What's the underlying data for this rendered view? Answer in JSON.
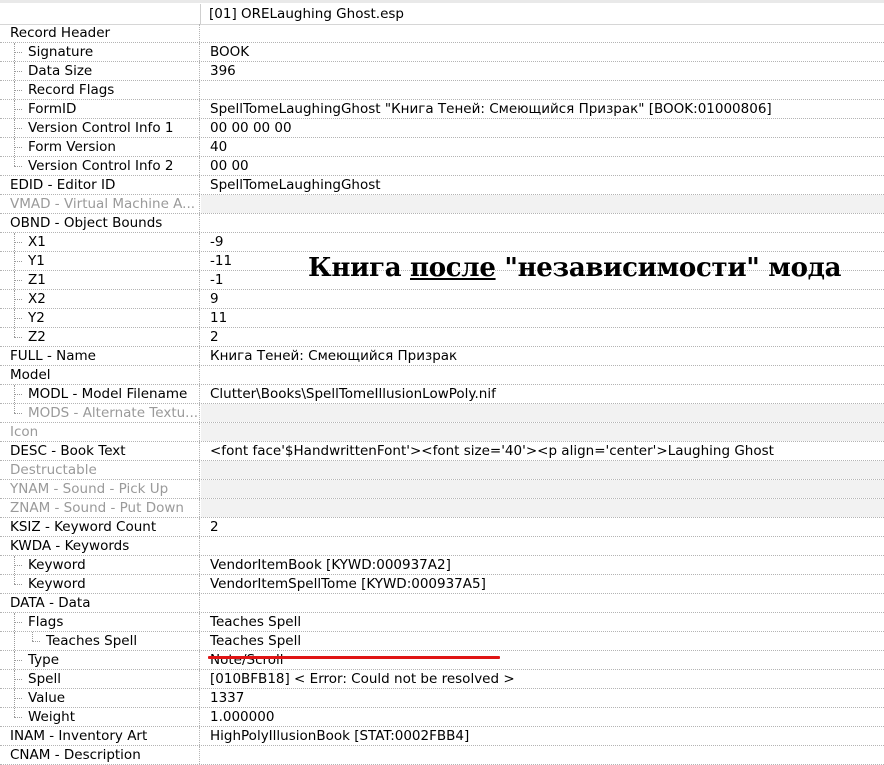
{
  "header": {
    "title": "[01] ORELaughing Ghost.esp"
  },
  "overlay": {
    "pre": "Книга ",
    "underlined": "после",
    "post": " \"независимости\" мода"
  },
  "rows": [
    {
      "label": "Record Header",
      "value": "",
      "level": 0
    },
    {
      "label": "Signature",
      "value": "BOOK",
      "level": 1
    },
    {
      "label": "Data Size",
      "value": "396",
      "level": 1
    },
    {
      "label": "Record Flags",
      "value": "",
      "level": 1
    },
    {
      "label": "FormID",
      "value": "SpellTomeLaughingGhost \"Книга Теней: Смеющийся Призрак\" [BOOK:01000806]",
      "level": 1
    },
    {
      "label": "Version Control Info 1",
      "value": "00 00 00 00",
      "level": 1
    },
    {
      "label": "Form Version",
      "value": "40",
      "level": 1
    },
    {
      "label": "Version Control Info 2",
      "value": "00 00",
      "level": 1,
      "last": true
    },
    {
      "label": "EDID - Editor ID",
      "value": "SpellTomeLaughingGhost",
      "level": 0
    },
    {
      "label": "VMAD - Virtual Machine A...",
      "value": "",
      "level": 0,
      "disabled": true
    },
    {
      "label": "OBND - Object Bounds",
      "value": "",
      "level": 0
    },
    {
      "label": "X1",
      "value": "-9",
      "level": 1
    },
    {
      "label": "Y1",
      "value": "-11",
      "level": 1
    },
    {
      "label": "Z1",
      "value": "-1",
      "level": 1
    },
    {
      "label": "X2",
      "value": "9",
      "level": 1
    },
    {
      "label": "Y2",
      "value": "11",
      "level": 1
    },
    {
      "label": "Z2",
      "value": "2",
      "level": 1,
      "last": true
    },
    {
      "label": "FULL - Name",
      "value": "Книга Теней: Смеющийся Призрак",
      "level": 0
    },
    {
      "label": "Model",
      "value": "",
      "level": 0
    },
    {
      "label": "MODL - Model Filename",
      "value": "Clutter\\Books\\SpellTomeIllusionLowPoly.nif",
      "level": 1
    },
    {
      "label": "MODS - Alternate Textu...",
      "value": "",
      "level": 1,
      "disabled": true,
      "last": true
    },
    {
      "label": "Icon",
      "value": "",
      "level": 0,
      "disabled": true
    },
    {
      "label": "DESC - Book Text",
      "value": "<font face'$HandwrittenFont'><font size='40'><p align='center'>Laughing Ghost",
      "level": 0
    },
    {
      "label": "Destructable",
      "value": "",
      "level": 0,
      "disabled": true
    },
    {
      "label": "YNAM - Sound - Pick Up",
      "value": "",
      "level": 0,
      "disabled": true
    },
    {
      "label": "ZNAM - Sound - Put Down",
      "value": "",
      "level": 0,
      "disabled": true
    },
    {
      "label": "KSIZ - Keyword Count",
      "value": "2",
      "level": 0
    },
    {
      "label": "KWDA - Keywords",
      "value": "",
      "level": 0
    },
    {
      "label": "Keyword",
      "value": "VendorItemBook [KYWD:000937A2]",
      "level": 1
    },
    {
      "label": "Keyword",
      "value": "VendorItemSpellTome [KYWD:000937A5]",
      "level": 1,
      "last": true
    },
    {
      "label": "DATA - Data",
      "value": "",
      "level": 0
    },
    {
      "label": "Flags",
      "value": "Teaches Spell",
      "level": 1
    },
    {
      "label": "Teaches Spell",
      "value": "Teaches Spell",
      "level": 2
    },
    {
      "label": "Type",
      "value": "Note/Scroll",
      "level": 1
    },
    {
      "label": "Spell",
      "value": "[010BFB18] < Error: Could not be resolved >",
      "level": 1
    },
    {
      "label": "Value",
      "value": "1337",
      "level": 1
    },
    {
      "label": "Weight",
      "value": "1.000000",
      "level": 1,
      "last": true
    },
    {
      "label": "INAM - Inventory Art",
      "value": "HighPolyIllusionBook [STAT:0002FBB4]",
      "level": 0
    },
    {
      "label": "CNAM - Description",
      "value": "",
      "level": 0
    }
  ]
}
